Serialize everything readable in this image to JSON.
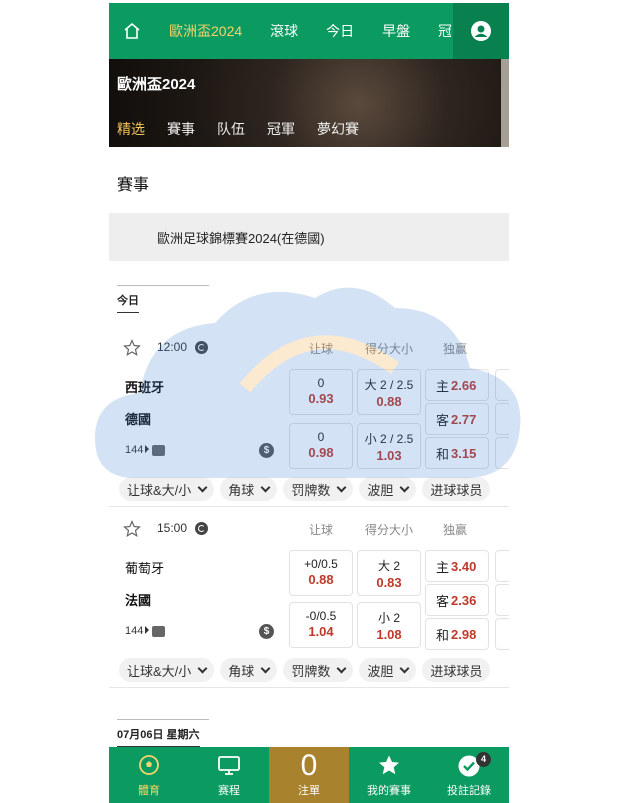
{
  "topnav": {
    "tabs": [
      {
        "label": "歐洲盃2024",
        "active": true
      },
      {
        "label": "滾球",
        "active": false
      },
      {
        "label": "今日",
        "active": false
      },
      {
        "label": "早盤",
        "active": false
      },
      {
        "label": "冠",
        "active": false
      }
    ]
  },
  "hero": {
    "title": "歐洲盃2024",
    "subtabs": [
      {
        "label": "精选",
        "active": true
      },
      {
        "label": "賽事",
        "active": false
      },
      {
        "label": "队伍",
        "active": false
      },
      {
        "label": "冠軍",
        "active": false
      },
      {
        "label": "夢幻賽",
        "active": false
      }
    ]
  },
  "section_title": "賽事",
  "competition": "歐洲足球錦標賽2024(在德國)",
  "day1": "今日",
  "day2": "07月06日 星期六",
  "headers": {
    "handicap": "让球",
    "overunder": "得分大小",
    "moneyline": "独赢"
  },
  "matches": [
    {
      "time": "12:00",
      "home": "西班牙",
      "away": "德國",
      "count": "144",
      "handicap": [
        {
          "line": "0",
          "odd": "0.93"
        },
        {
          "line": "0",
          "odd": "0.98"
        }
      ],
      "overunder": [
        {
          "line": "大 2 / 2.5",
          "odd": "0.88"
        },
        {
          "line": "小 2 / 2.5",
          "odd": "1.03"
        }
      ],
      "moneyline": [
        {
          "label": "主",
          "odd": "2.66"
        },
        {
          "label": "客",
          "odd": "2.77"
        },
        {
          "label": "和",
          "odd": "3.15"
        }
      ]
    },
    {
      "time": "15:00",
      "home": "葡萄牙",
      "away": "法國",
      "count": "144",
      "handicap": [
        {
          "line": "+0/0.5",
          "odd": "0.88"
        },
        {
          "line": "-0/0.5",
          "odd": "1.04"
        }
      ],
      "overunder": [
        {
          "line": "大 2",
          "odd": "0.83"
        },
        {
          "line": "小 2",
          "odd": "1.08"
        }
      ],
      "moneyline": [
        {
          "label": "主",
          "odd": "3.40"
        },
        {
          "label": "客",
          "odd": "2.36"
        },
        {
          "label": "和",
          "odd": "2.98"
        }
      ]
    }
  ],
  "chips": [
    "让球&大/小",
    "角球",
    "罚牌数",
    "波胆",
    "进球球员"
  ],
  "dollar_symbol": "$",
  "bottom": {
    "items": [
      {
        "label": "體育",
        "icon": "soccer-ball-icon"
      },
      {
        "label": "赛程",
        "icon": "monitor-icon"
      },
      {
        "label": "注單",
        "value": "0"
      },
      {
        "label": "我的賽事",
        "icon": "star-icon"
      },
      {
        "label": "投註記錄",
        "icon": "check-circle-icon",
        "badge": "4"
      }
    ]
  },
  "colors": {
    "primary": "#0b9a60",
    "accent": "#f3d46b",
    "odds": "#c0392b",
    "bet": "#a8822c"
  }
}
